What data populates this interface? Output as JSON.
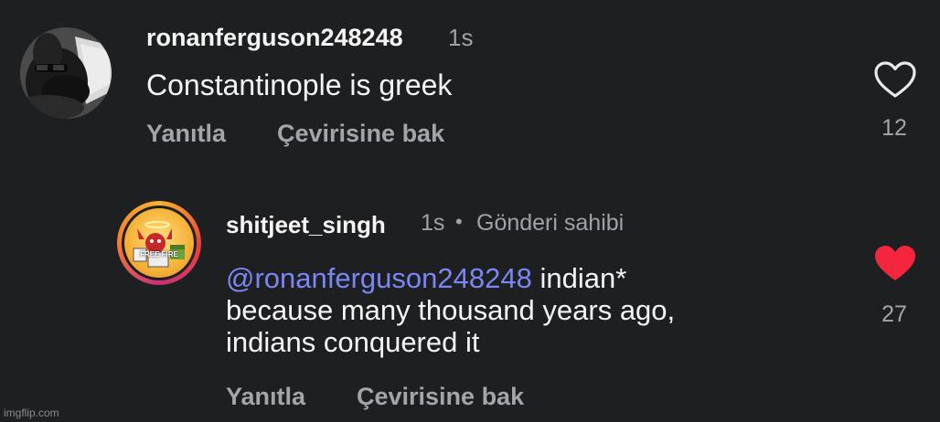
{
  "comments": [
    {
      "username": "ronanferguson248248",
      "time": "1s",
      "text": "Constantinople is greek",
      "reply_label": "Yanıtla",
      "translate_label": "Çevirisine bak",
      "like_count": "12",
      "liked": false
    },
    {
      "username": "shitjeet_singh",
      "time": "1s",
      "separator": "•",
      "badge": "Gönderi sahibi",
      "mention": "@ronanferguson248248",
      "text_line1": " indian*",
      "text_line2": "because many thousand years ago,",
      "text_line3": "indians conquered it",
      "reply_label": "Yanıtla",
      "translate_label": "Çevirisine bak",
      "like_count": "27",
      "liked": true,
      "avatar_text": "FREE FIRE"
    }
  ],
  "colors": {
    "background": "#1e1f21",
    "mention": "#7b86f5",
    "liked_heart": "#f3263e",
    "muted": "#a2a6ab"
  },
  "watermark": "imgflip.com"
}
